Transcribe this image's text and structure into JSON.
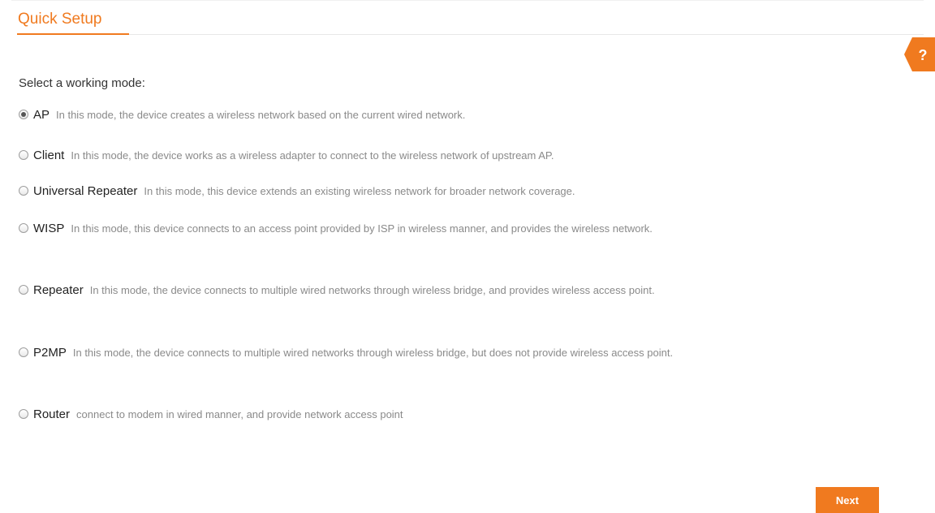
{
  "header": {
    "title": "Quick Setup"
  },
  "help": {
    "icon": "help-icon",
    "label": "?"
  },
  "form": {
    "prompt": "Select a working mode:",
    "selected": "AP",
    "modes": [
      {
        "name": "AP",
        "description": "In this mode, the device creates a wireless network based on the current wired network."
      },
      {
        "name": "Client",
        "description": "In this mode, the device works as a wireless adapter to connect to the wireless network of upstream AP."
      },
      {
        "name": "Universal Repeater",
        "description": "In this mode, this device extends an existing wireless network for broader network coverage."
      },
      {
        "name": "WISP",
        "description": "In this mode, this device connects to an access point provided by ISP in wireless manner, and provides the wireless network."
      },
      {
        "name": "Repeater",
        "description": "In this mode, the device connects to multiple wired networks through wireless bridge, and provides wireless access point."
      },
      {
        "name": "P2MP",
        "description": "In this mode, the device connects to multiple wired networks through wireless bridge, but does not provide wireless access point."
      },
      {
        "name": "Router",
        "description": "connect to modem in wired manner, and provide network access point"
      }
    ]
  },
  "actions": {
    "next_label": "Next"
  },
  "colors": {
    "accent": "#f07a1f",
    "text": "#333333",
    "muted": "#8a8a8a"
  }
}
